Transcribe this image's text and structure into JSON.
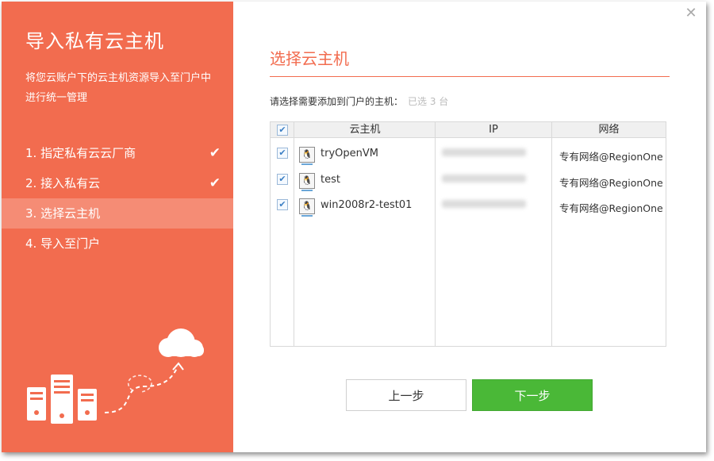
{
  "sidebar": {
    "title": "导入私有云主机",
    "description": "将您云账户下的云主机资源导入至门户中进行统一管理",
    "steps": [
      {
        "label": "1. 指定私有云云厂商",
        "done": true
      },
      {
        "label": "2. 接入私有云",
        "done": true
      },
      {
        "label": "3. 选择云主机",
        "done": false,
        "active": true
      },
      {
        "label": "4. 导入至门户",
        "done": false
      }
    ],
    "check_glyph": "✔"
  },
  "close_glyph": "✕",
  "main": {
    "title": "选择云主机",
    "prompt": "请选择需要添加到门户的主机：",
    "selected_count": "已选 3 台",
    "table": {
      "columns": [
        "云主机",
        "IP",
        "网络"
      ],
      "rows": [
        {
          "name": "tryOpenVM",
          "ip": "",
          "network": "专有网络@RegionOne",
          "checked": true
        },
        {
          "name": "test",
          "ip": "",
          "network": "专有网络@RegionOne",
          "checked": true
        },
        {
          "name": "win2008r2-test01",
          "ip": "",
          "network": "专有网络@RegionOne",
          "checked": true
        }
      ]
    },
    "prev_button": "上一步",
    "next_button": "下一步"
  },
  "icons": {
    "vm": "linux-vm-icon",
    "check": "checkmark-icon",
    "close": "close-icon"
  },
  "colors": {
    "accent": "#f26c4f",
    "primary_button": "#4ab837"
  }
}
